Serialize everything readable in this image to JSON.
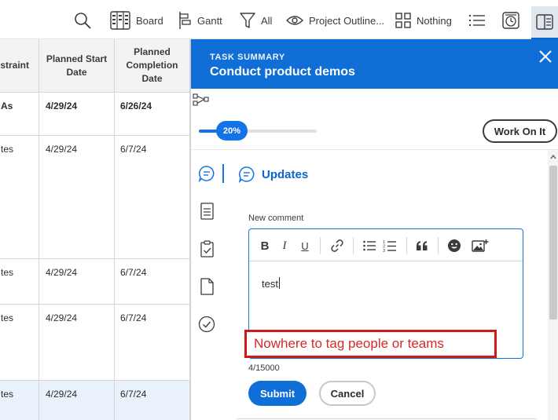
{
  "toolbar": {
    "board_label": "Board",
    "gantt_label": "Gantt",
    "filter_label": "All",
    "view_label": "Project Outline...",
    "grouping_label": "Nothing"
  },
  "grid": {
    "headers": [
      "straint",
      "Planned Start Date",
      "Planned Completion Date"
    ],
    "rows": [
      {
        "constraint": "As",
        "start": "4/29/24",
        "completion": "6/26/24"
      },
      {
        "constraint": "tes",
        "start": "4/29/24",
        "completion": "6/7/24"
      },
      {
        "constraint": "tes",
        "start": "4/29/24",
        "completion": "6/7/24"
      },
      {
        "constraint": "tes",
        "start": "4/29/24",
        "completion": "6/7/24"
      },
      {
        "constraint": "tes",
        "start": "4/29/24",
        "completion": "6/7/24"
      }
    ]
  },
  "panel": {
    "kicker": "TASK SUMMARY",
    "title": "Conduct product demos",
    "progress_label": "20%",
    "progress_value": 0.2,
    "work_on_it_label": "Work On It",
    "updates_label": "Updates",
    "new_comment_label": "New comment",
    "comment_text": "test",
    "counter": "4/15000",
    "submit_label": "Submit",
    "cancel_label": "Cancel"
  },
  "annotation": {
    "text": "Nowhere to tag people or teams",
    "color": "#d01818"
  },
  "colors": {
    "accent": "#0f6fd6",
    "selected_row": "#e9f1fb"
  }
}
